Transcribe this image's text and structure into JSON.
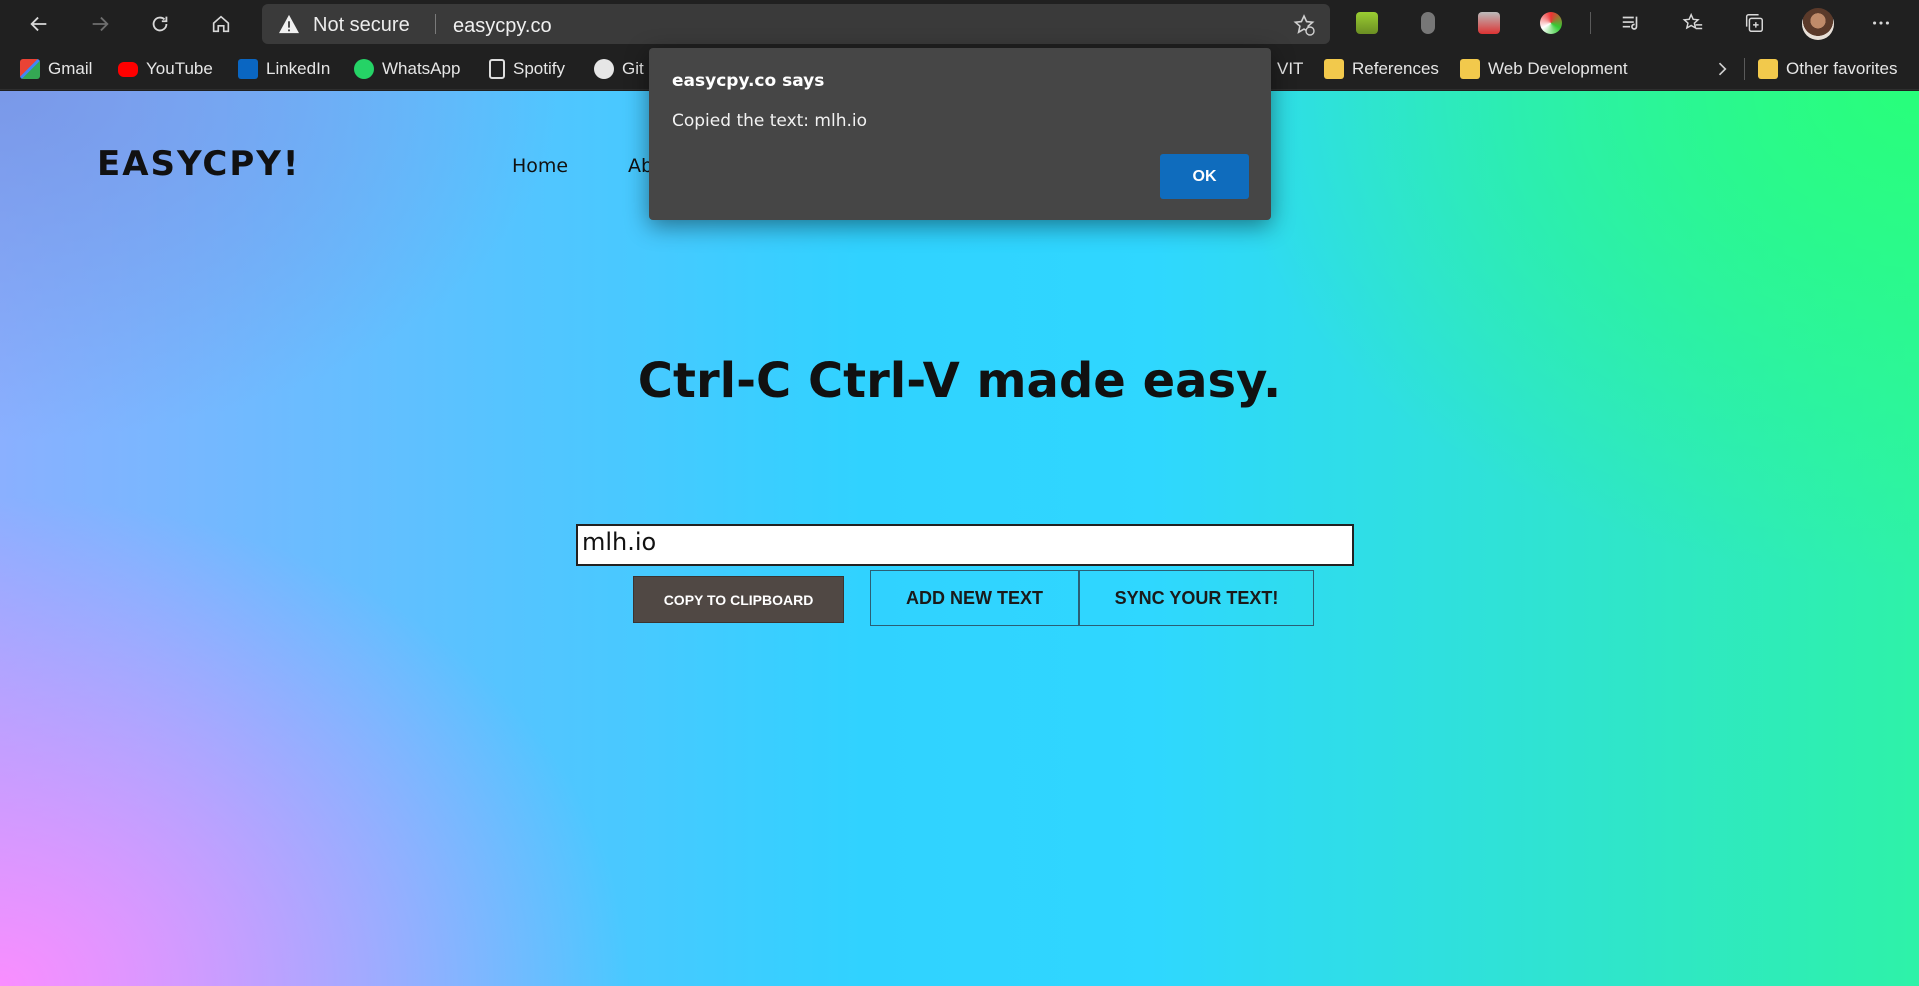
{
  "browser": {
    "security_label": "Not secure",
    "url": "easycpy.co",
    "bookmarks": [
      {
        "label": "Gmail"
      },
      {
        "label": "YouTube"
      },
      {
        "label": "LinkedIn"
      },
      {
        "label": "WhatsApp"
      },
      {
        "label": "Spotify"
      },
      {
        "label": "Git"
      },
      {
        "label": "VIT"
      },
      {
        "label": "References"
      },
      {
        "label": "Web Development"
      },
      {
        "label": "Other favorites"
      }
    ]
  },
  "page": {
    "logo": "EASYCPY!",
    "nav": [
      "Home",
      "Ab"
    ],
    "headline": "Ctrl-C Ctrl-V made easy.",
    "input_value": "mlh.io",
    "buttons": {
      "copy": "COPY TO CLIPBOARD",
      "add": "ADD NEW TEXT",
      "sync": "SYNC YOUR TEXT!"
    }
  },
  "dialog": {
    "title": "easycpy.co says",
    "message": "Copied the text: mlh.io",
    "ok_label": "OK"
  },
  "colors": {
    "dialog_bg": "#464646",
    "ok_button": "#0f6cbd",
    "copy_button": "#504844"
  }
}
